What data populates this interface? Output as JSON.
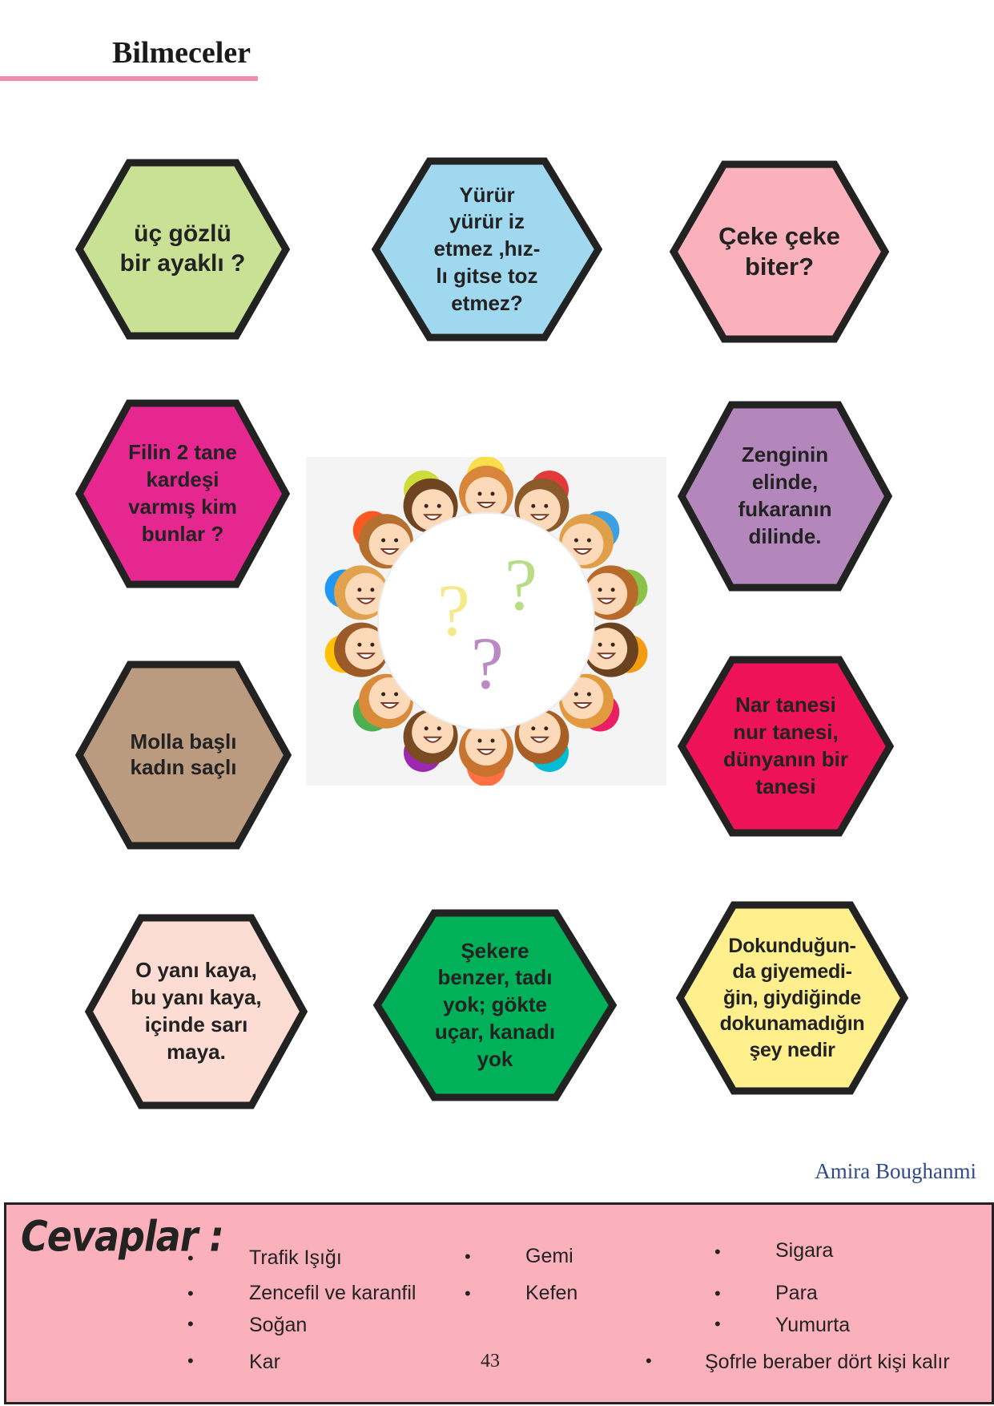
{
  "page": {
    "title": "Bilmeceler",
    "author": "Amira Boughanmi",
    "page_number": "43"
  },
  "riddles": [
    {
      "text": "üç gözlü\nbir ayaklı ?",
      "color": "#c8e194"
    },
    {
      "text": "Yürür\nyürür iz\netmez ,hız-\nlı gitse toz\netmez?",
      "color": "#a0d8ef"
    },
    {
      "text": "Çeke çeke\nbiter?",
      "color": "#fbb1bb"
    },
    {
      "text": "Filin 2 tane\nkardeşi\nvarmış kim\nbunlar ?",
      "color": "#e5278f"
    },
    {
      "text": "Zenginin\nelinde,\nfukaranın\ndilinde.",
      "color": "#b387bb"
    },
    {
      "text": "Molla başlı\nkadın saçlı",
      "color": "#bb9b80"
    },
    {
      "text": "Nar tanesi\nnur tanesi,\ndünyanın bir\ntanesi",
      "color": "#ee1259"
    },
    {
      "text": "O yanı kaya,\nbu yanı kaya,\niçinde sarı\nmaya.",
      "color": "#fddcd3"
    },
    {
      "text": "Şekere\nbenzer, tadı\nyok; gökte\nuçar, kanadı\nyok",
      "color": "#00b159"
    },
    {
      "text": "Dokunduğun-\nda giyemedi-\nğin, giydiğinde\ndokunamadığın\nşey nedir",
      "color": "#fff08d"
    }
  ],
  "answers": {
    "title": "Cevaplar :",
    "items": [
      "Trafik Işığı",
      "Zencefil ve karanfil",
      "Soğan",
      "Kar",
      "Gemi",
      "Kefen",
      "Sigara",
      "Para",
      "Yumurta",
      "Şofrle beraber dört kişi kalır"
    ]
  },
  "illustration": {
    "marks": [
      "?",
      "?",
      "?"
    ],
    "mark_colors": [
      "#f7e98a",
      "#b9dc86",
      "#b98ac4"
    ]
  }
}
